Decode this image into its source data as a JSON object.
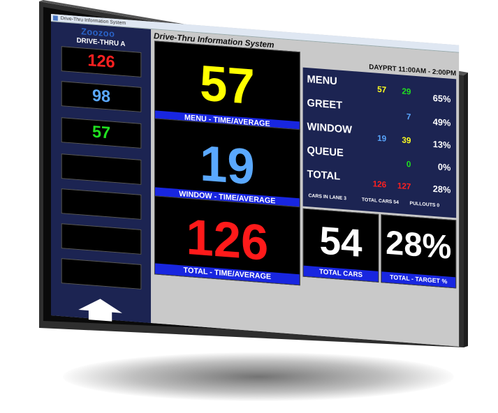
{
  "window": {
    "title": "Drive-Thru Information System"
  },
  "sidebar": {
    "logo": "Zoozoo",
    "lane_label": "DRIVE-THRU A",
    "cells": [
      {
        "value": "126",
        "color": "#ff2020"
      },
      {
        "value": "98",
        "color": "#5aa8ff"
      },
      {
        "value": "57",
        "color": "#20e020"
      },
      {
        "value": "",
        "color": "#ffffff"
      },
      {
        "value": "",
        "color": "#ffffff"
      },
      {
        "value": "",
        "color": "#ffffff"
      },
      {
        "value": "",
        "color": "#ffffff"
      }
    ],
    "scroll_icon": "up-arrow-icon"
  },
  "main": {
    "title": "Drive-Thru Information System",
    "daypart": "DAYPRT 11:00AM - 2:00PM",
    "panels": {
      "menu": {
        "value": "57",
        "caption": "MENU - TIME/AVERAGE",
        "color": "#ffff00"
      },
      "window": {
        "value": "19",
        "caption": "WINDOW - TIME/AVERAGE",
        "color": "#5aa8ff"
      },
      "total": {
        "value": "126",
        "caption": "TOTAL - TIME/AVERAGE",
        "color": "#ff1a1a"
      },
      "cars": {
        "value": "54",
        "caption": "TOTAL CARS",
        "color": "#ffffff"
      },
      "target": {
        "value": "28%",
        "caption": "TOTAL - TARGET %",
        "color": "#ffffff"
      }
    },
    "stats": {
      "rows": [
        {
          "label": "MENU",
          "a": "57",
          "b": "29",
          "pct": "65%"
        },
        {
          "label": "GREET",
          "a": "",
          "b": "7",
          "pct": "49%"
        },
        {
          "label": "WINDOW",
          "a": "19",
          "b": "39",
          "pct": "13%"
        },
        {
          "label": "QUEUE",
          "a": "",
          "b": "0",
          "pct": "0%"
        },
        {
          "label": "TOTAL",
          "a": "126",
          "b": "127",
          "pct": "28%"
        }
      ],
      "footer": {
        "cars_in_lane": "CARS IN LANE  3",
        "total_cars": "TOTAL CARS  54",
        "pullouts": "PULLOUTS  0"
      }
    }
  }
}
